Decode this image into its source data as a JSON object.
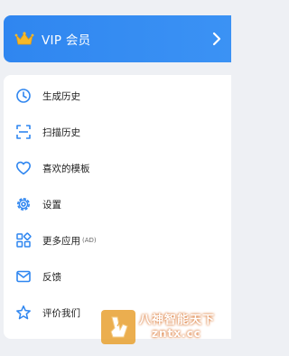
{
  "vip": {
    "label": "VIP 会员",
    "crown_color": "#f5b82a",
    "background": "#3089f1"
  },
  "menu": {
    "items": [
      {
        "label": "生成历史",
        "sub": "",
        "icon": "clock-icon"
      },
      {
        "label": "扫描历史",
        "sub": "",
        "icon": "scan-icon"
      },
      {
        "label": "喜欢的模板",
        "sub": "",
        "icon": "heart-icon"
      },
      {
        "label": "设置",
        "sub": "",
        "icon": "gear-icon"
      },
      {
        "label": "更多应用",
        "sub": "(AD)",
        "icon": "apps-icon"
      },
      {
        "label": "反馈",
        "sub": "",
        "icon": "mail-icon"
      },
      {
        "label": "评价我们",
        "sub": "",
        "icon": "star-icon"
      }
    ],
    "icon_color": "#2f86f0"
  },
  "watermark": {
    "title": "八神智能天下",
    "domain": "zntx.cc"
  }
}
